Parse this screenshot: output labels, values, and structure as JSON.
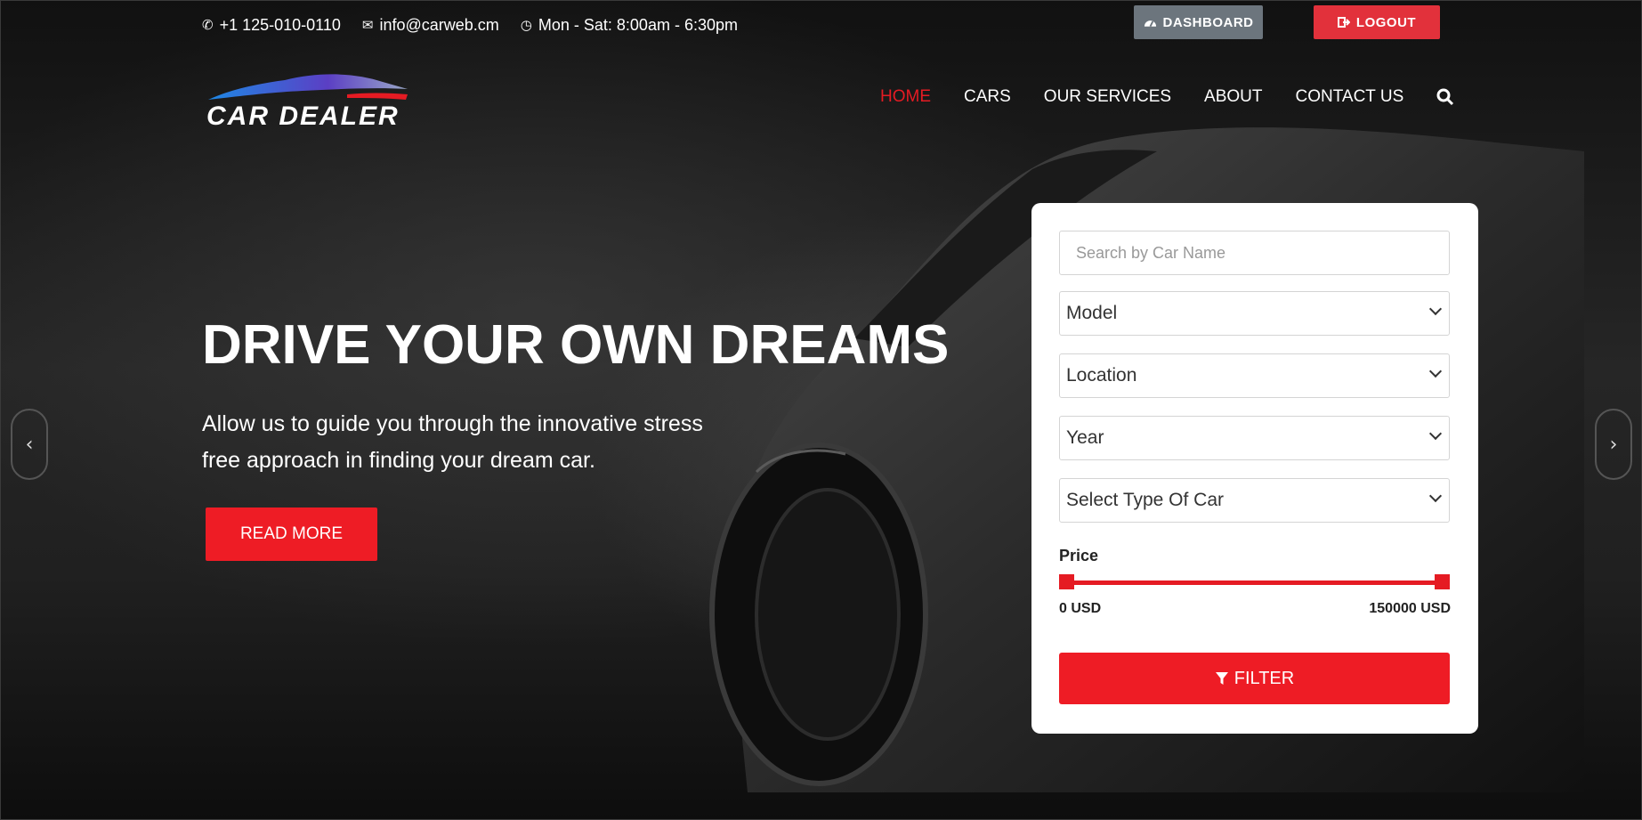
{
  "topbar": {
    "phone": "+1 125-010-0110",
    "email": "info@carweb.cm",
    "hours": "Mon - Sat: 8:00am - 6:30pm",
    "phone_icon": "phone-icon",
    "email_icon": "envelope-icon",
    "hours_icon": "clock-icon"
  },
  "account": {
    "dashboard_label": "DASHBOARD",
    "logout_label": "LOGOUT"
  },
  "brand": {
    "logo_text": "CAR DEALER"
  },
  "nav": {
    "items": [
      "HOME",
      "CARS",
      "OUR SERVICES",
      "ABOUT",
      "CONTACT US"
    ],
    "active": "HOME",
    "search_icon": "search-icon"
  },
  "hero": {
    "headline": "DRIVE YOUR OWN DREAMS",
    "subline_1": "Allow us to guide you through the innovative stress",
    "subline_2": "free approach in finding your dream car.",
    "cta_label": "READ MORE"
  },
  "filter": {
    "search_placeholder": "Search by Car Name",
    "model": "Model",
    "location": "Location",
    "year": "Year",
    "type": "Select Type Of Car",
    "price_label": "Price",
    "price_min": "0 USD",
    "price_max": "150000 USD",
    "price_low_fraction": 0,
    "price_high_fraction": 1,
    "button_label": "FILTER"
  },
  "colors": {
    "accent": "#ee1c25",
    "dashboard": "#6c757d"
  }
}
